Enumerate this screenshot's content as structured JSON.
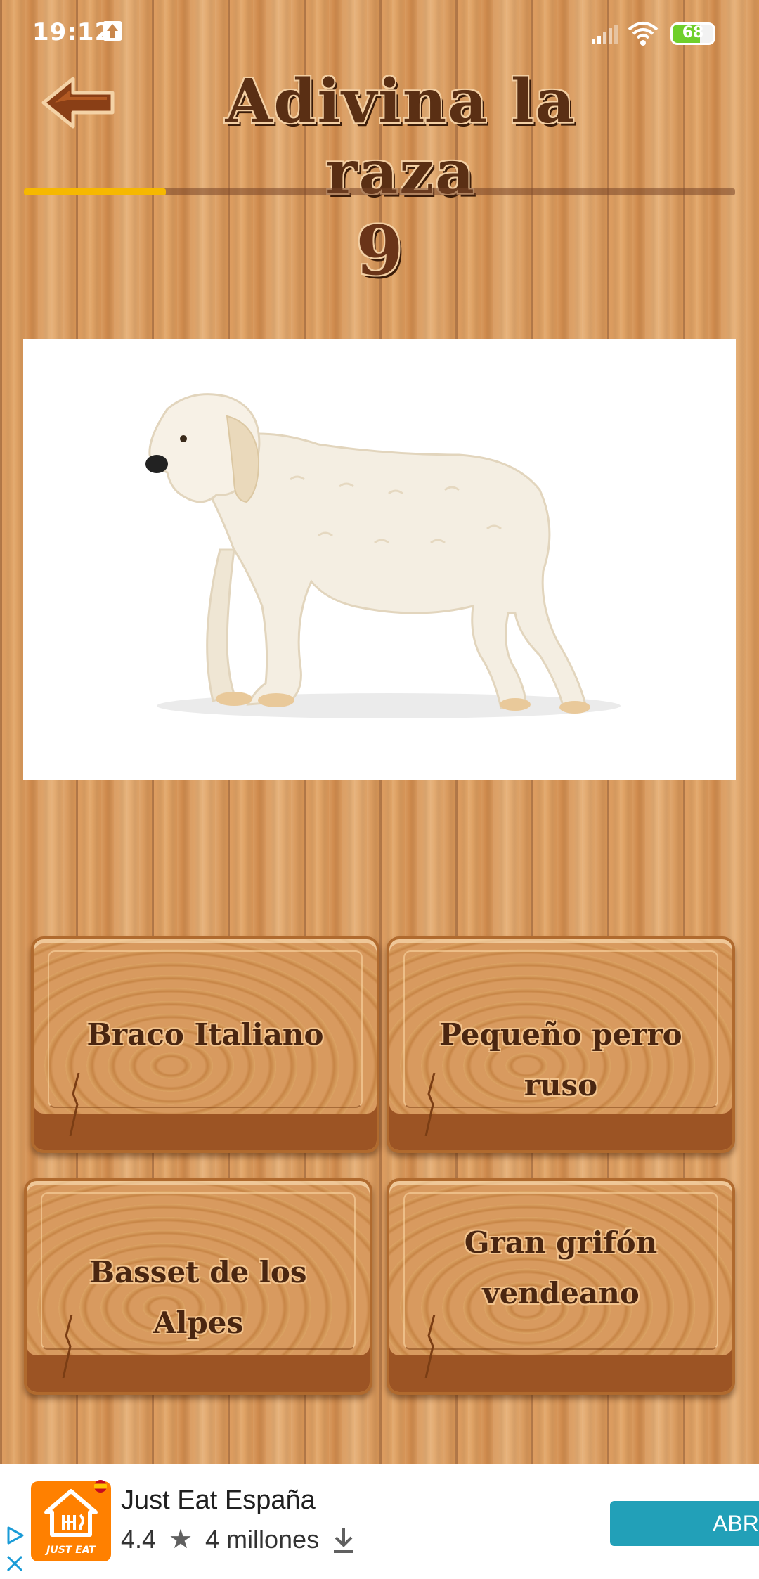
{
  "status_bar": {
    "time": "19:12",
    "battery_level": "68",
    "icons": [
      "upload-icon",
      "signal-icon",
      "wifi-icon",
      "battery-icon"
    ]
  },
  "header": {
    "title": "Adivina la raza",
    "back_icon": "arrow-left-icon"
  },
  "progress": {
    "fraction": 0.2,
    "question_number": "9"
  },
  "question": {
    "image": "dog-photo"
  },
  "answers": [
    {
      "label": "Braco Italiano"
    },
    {
      "label": "Pequeño perro ruso"
    },
    {
      "label": "Basset de los Alpes"
    },
    {
      "label": "Gran grifón vendeano"
    }
  ],
  "ad": {
    "title": "Just Eat España",
    "rating": "4.4",
    "installs": "4 millones",
    "cta_label": "ABR",
    "logo_text": "JUST EAT",
    "colors": {
      "logo": "#ff8000",
      "cta": "#22a0b8"
    }
  }
}
